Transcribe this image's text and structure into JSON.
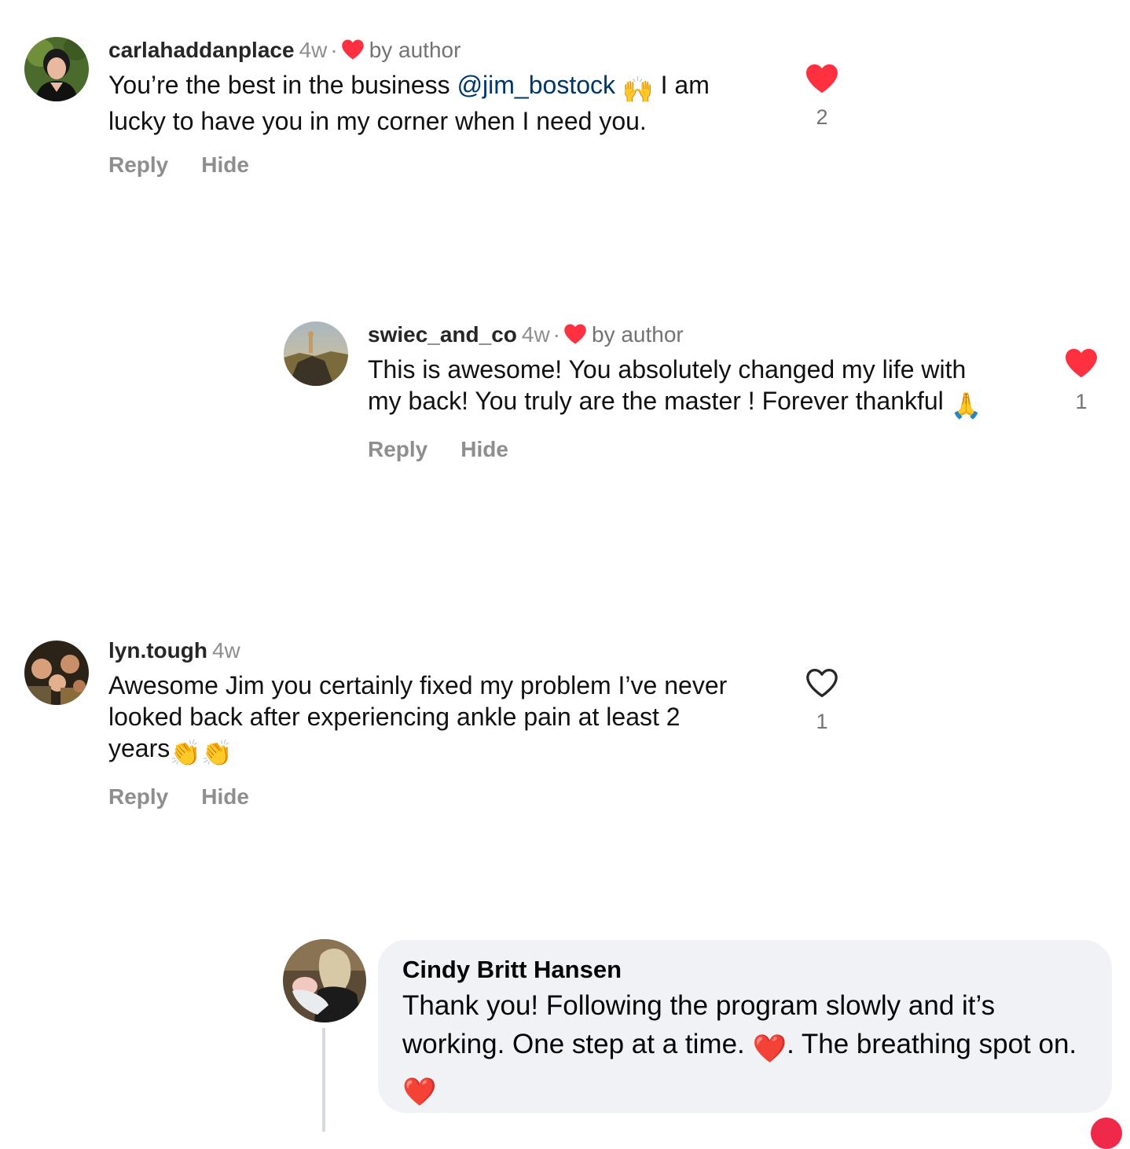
{
  "comments": [
    {
      "username": "carlahaddanplace",
      "time": "4w",
      "separator": "·",
      "by_author": "by author",
      "text_before": "You’re the best in the business ",
      "mention": "@jim_bostock",
      "text_emoji": "🙌",
      "text_after": " I am lucky to have you in my corner when I need you.",
      "reply_label": "Reply",
      "hide_label": "Hide",
      "like_count": "2",
      "liked": true
    },
    {
      "username": "swiec_and_co",
      "time": "4w",
      "separator": "·",
      "by_author": "by author",
      "text": "This is awesome! You absolutely changed my life with my back! You truly are the master ! Forever thankful ",
      "text_emoji": "🙏",
      "reply_label": "Reply",
      "hide_label": "Hide",
      "like_count": "1",
      "liked": true
    },
    {
      "username": "lyn.tough",
      "time": "4w",
      "text": "Awesome Jim you certainly fixed my problem I’ve never looked back after experiencing ankle pain at least 2 years",
      "text_emoji": "👏👏",
      "reply_label": "Reply",
      "hide_label": "Hide",
      "like_count": "1",
      "liked": false
    }
  ],
  "fb_comment": {
    "name": "Cindy Britt Hansen",
    "text_part1": "Thank you!  Following the program slowly and it’s working. One step at a time. ",
    "emoji1": "❤️",
    "text_part2": ". The breathing spot on. ",
    "emoji2": "❤️"
  },
  "colors": {
    "heart_red": "#ff3040",
    "muted_text": "#8e8e8e",
    "mention": "#00376b",
    "fb_bubble": "#f0f2f5"
  },
  "icons": {
    "liked_heart": "heart-filled-icon",
    "unliked_heart": "heart-outline-icon",
    "author_heart": "heart-filled-icon"
  }
}
